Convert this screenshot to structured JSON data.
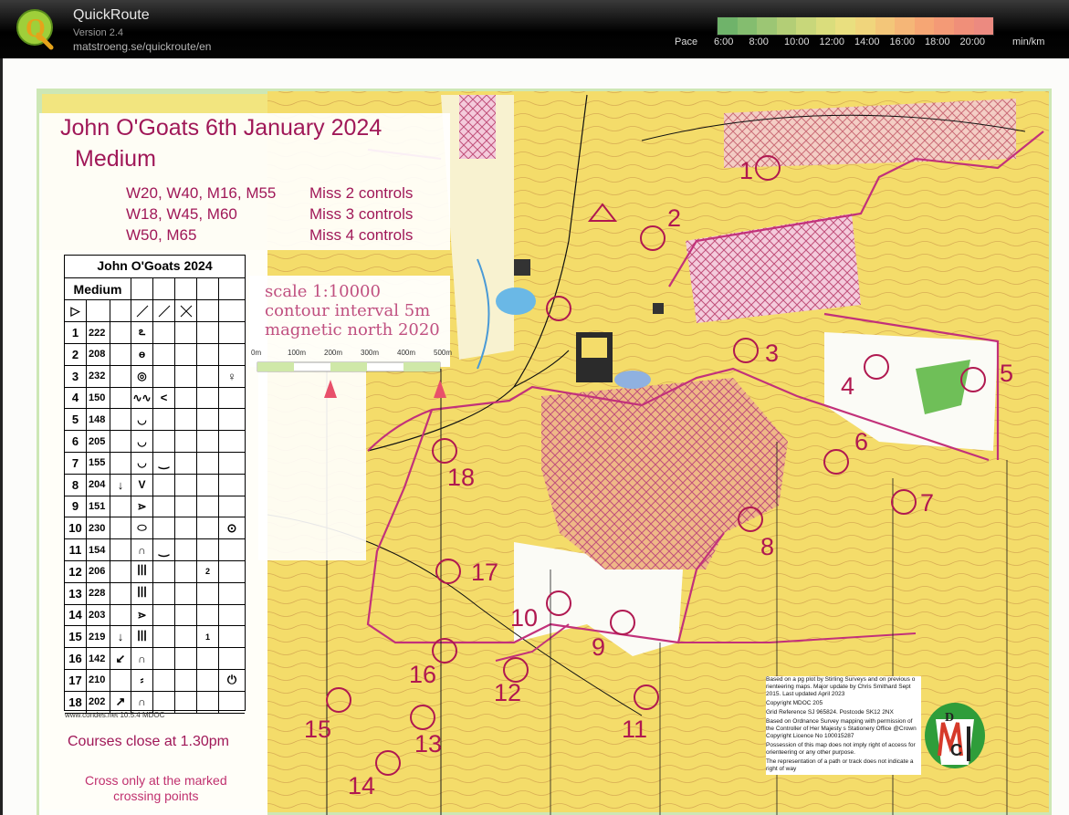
{
  "app": {
    "name": "QuickRoute",
    "version": "Version 2.4",
    "url": "matstroeng.se/quickroute/en",
    "logo_letter": "Q"
  },
  "pace": {
    "label": "Pace",
    "ticks": [
      "6:00",
      "8:00",
      "10:00",
      "12:00",
      "14:00",
      "16:00",
      "18:00",
      "20:00"
    ],
    "unit": "min/km",
    "colors": [
      "#6fb36a",
      "#84bd6f",
      "#9cc674",
      "#b3ce76",
      "#c8d77a",
      "#dadd7c",
      "#e9df7f",
      "#f0d57c",
      "#f3c679",
      "#f5b677",
      "#f6a674",
      "#f49a76",
      "#f08f79",
      "#ec8a80"
    ]
  },
  "map": {
    "title": "John O'Goats 6th January 2024",
    "subtitle": "Medium",
    "classes": [
      {
        "names": "W20, W40, M16, M55",
        "rule": "Miss 2 controls"
      },
      {
        "names": "W18, W45, M60",
        "rule": "Miss 3 controls"
      },
      {
        "names": "W50, M65",
        "rule": "Miss 4 controls"
      }
    ],
    "scale_lines": [
      "scale 1:10000",
      "contour interval 5m",
      "magnetic north 2020"
    ],
    "scale_ticks": [
      "0m",
      "100m",
      "200m",
      "300m",
      "400m",
      "500m"
    ],
    "description_sheet": {
      "event": "John O'Goats 2024",
      "course": "Medium",
      "start_symbol": "▷",
      "controls": [
        {
          "num": "1",
          "code": "222",
          "c3": "",
          "c4": "ఽ",
          "c5": "",
          "c6": "",
          "c7": "",
          "c8": ""
        },
        {
          "num": "2",
          "code": "208",
          "c3": "",
          "c4": "ɵ",
          "c5": "",
          "c6": "",
          "c7": "",
          "c8": ""
        },
        {
          "num": "3",
          "code": "232",
          "c3": "",
          "c4": "◎",
          "c5": "",
          "c6": "",
          "c7": "",
          "c8": "♀"
        },
        {
          "num": "4",
          "code": "150",
          "c3": "",
          "c4": "∿∿",
          "c5": "<",
          "c6": "",
          "c7": "",
          "c8": ""
        },
        {
          "num": "5",
          "code": "148",
          "c3": "",
          "c4": "◡",
          "c5": "",
          "c6": "",
          "c7": "",
          "c8": ""
        },
        {
          "num": "6",
          "code": "205",
          "c3": "",
          "c4": "◡",
          "c5": "",
          "c6": "",
          "c7": "",
          "c8": ""
        },
        {
          "num": "7",
          "code": "155",
          "c3": "",
          "c4": "◡",
          "c5": "‿",
          "c6": "",
          "c7": "",
          "c8": ""
        },
        {
          "num": "8",
          "code": "204",
          "c3": "↓",
          "c4": "V",
          "c5": "",
          "c6": "",
          "c7": "",
          "c8": ""
        },
        {
          "num": "9",
          "code": "151",
          "c3": "",
          "c4": "⋗",
          "c5": "",
          "c6": "",
          "c7": "",
          "c8": ""
        },
        {
          "num": "10",
          "code": "230",
          "c3": "",
          "c4": "⬭",
          "c5": "",
          "c6": "",
          "c7": "",
          "c8": "⊙"
        },
        {
          "num": "11",
          "code": "154",
          "c3": "",
          "c4": "∩",
          "c5": "‿",
          "c6": "",
          "c7": "",
          "c8": ""
        },
        {
          "num": "12",
          "code": "206",
          "c3": "",
          "c4": "ꟾꟾꟾ",
          "c5": "",
          "c6": "",
          "c7": "2",
          "c8": ""
        },
        {
          "num": "13",
          "code": "228",
          "c3": "",
          "c4": "ꟾꟾꟾ",
          "c5": "",
          "c6": "",
          "c7": "",
          "c8": ""
        },
        {
          "num": "14",
          "code": "203",
          "c3": "",
          "c4": "⋗",
          "c5": "",
          "c6": "",
          "c7": "",
          "c8": ""
        },
        {
          "num": "15",
          "code": "219",
          "c3": "↓",
          "c4": "ꟾꟾꟾ",
          "c5": "",
          "c6": "",
          "c7": "1",
          "c8": ""
        },
        {
          "num": "16",
          "code": "142",
          "c3": "↙",
          "c4": "∩",
          "c5": "",
          "c6": "",
          "c7": "",
          "c8": ""
        },
        {
          "num": "17",
          "code": "210",
          "c3": "",
          "c4": "⸗",
          "c5": "",
          "c6": "",
          "c7": "",
          "c8": "⏻"
        },
        {
          "num": "18",
          "code": "202",
          "c3": "↗",
          "c4": "∩",
          "c5": "",
          "c6": "",
          "c7": "",
          "c8": ""
        }
      ],
      "footer": "www.condes.net 10.5.4 MDOC"
    },
    "closing_note": "Courses close at 1.30pm",
    "crossing_note_1": "Cross only at the marked",
    "crossing_note_2": "crossing points",
    "control_labels": [
      {
        "label": "1"
      },
      {
        "label": "2"
      },
      {
        "label": "3"
      },
      {
        "label": "4"
      },
      {
        "label": "5"
      },
      {
        "label": "6"
      },
      {
        "label": "7"
      },
      {
        "label": "8"
      },
      {
        "label": "9"
      },
      {
        "label": "10"
      },
      {
        "label": "11"
      },
      {
        "label": "12"
      },
      {
        "label": "13"
      },
      {
        "label": "14"
      },
      {
        "label": "15"
      },
      {
        "label": "16"
      },
      {
        "label": "17"
      },
      {
        "label": "18"
      }
    ],
    "credits": [
      "Based on a pg plot by Stirling Surveys and on previous o rienteering maps. Major update by Chris Smithard Sept 2015. Last updated April 2023",
      "Copyright MDOC 205",
      "Grid Reference SJ 965824. Postcode SK12 2NX",
      "Based on Ordnance Survey mapping with permission of the Controller of Her Majesty s Stationery Office @Crown Copyright Licence No 100015287",
      "Possession of this map does not imply right of access for orienteering or any other purpose.",
      "The representation of a path or track does not indicate a right of way"
    ],
    "club_logo_letters": "MDOC"
  }
}
